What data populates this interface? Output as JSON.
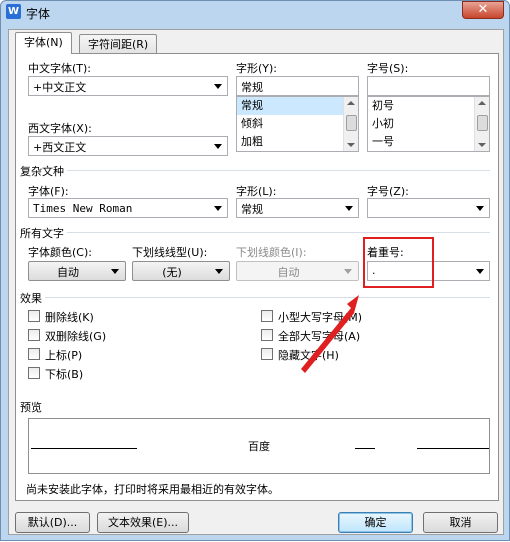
{
  "window": {
    "title": "字体",
    "icon_letter": "W",
    "close_glyph": "✕"
  },
  "tabs": [
    {
      "label": "字体(N)",
      "active": true
    },
    {
      "label": "字符间距(R)",
      "active": false
    }
  ],
  "chinese_font": {
    "label": "中文字体(T):",
    "value": "+中文正文"
  },
  "font_style": {
    "label": "字形(Y):",
    "value": "常规",
    "options": [
      "常规",
      "倾斜",
      "加粗"
    ],
    "selected": "常规"
  },
  "font_size": {
    "label": "字号(S):",
    "value": "",
    "options": [
      "初号",
      "小初",
      "一号"
    ]
  },
  "western_font": {
    "label": "西文字体(X):",
    "value": "+西文正文"
  },
  "complex": {
    "group_title": "复杂文种",
    "font_label": "字体(F):",
    "font_value": "Times New Roman",
    "style_label": "字形(L):",
    "style_value": "常规",
    "size_label": "字号(Z):",
    "size_value": ""
  },
  "all_text": {
    "group_title": "所有文字",
    "font_color_label": "字体颜色(C):",
    "font_color_value": "自动",
    "underline_type_label": "下划线线型(U):",
    "underline_type_value": "(无)",
    "underline_color_label": "下划线颜色(I):",
    "underline_color_value": "自动",
    "emphasis_label": "着重号:",
    "emphasis_value": "."
  },
  "effects": {
    "group_title": "效果",
    "left": [
      "删除线(K)",
      "双删除线(G)",
      "上标(P)",
      "下标(B)"
    ],
    "right": [
      "小型大写字母(M)",
      "全部大写字母(A)",
      "隐藏文字(H)"
    ]
  },
  "preview": {
    "group_title": "预览",
    "sample_text": "百度"
  },
  "note_text": "尚未安装此字体，打印时将采用最相近的有效字体。",
  "buttons": {
    "default_label": "默认(D)...",
    "text_effects_label": "文本效果(E)...",
    "ok_label": "确定",
    "cancel_label": "取消"
  },
  "colors": {
    "annotation_red": "#e02020",
    "list_selection": "#cce8ff",
    "title_bar": "#bcd6ef"
  },
  "icons": {
    "app": "wps-writer-icon",
    "close": "close-icon",
    "dropdown": "chevron-down-icon"
  }
}
